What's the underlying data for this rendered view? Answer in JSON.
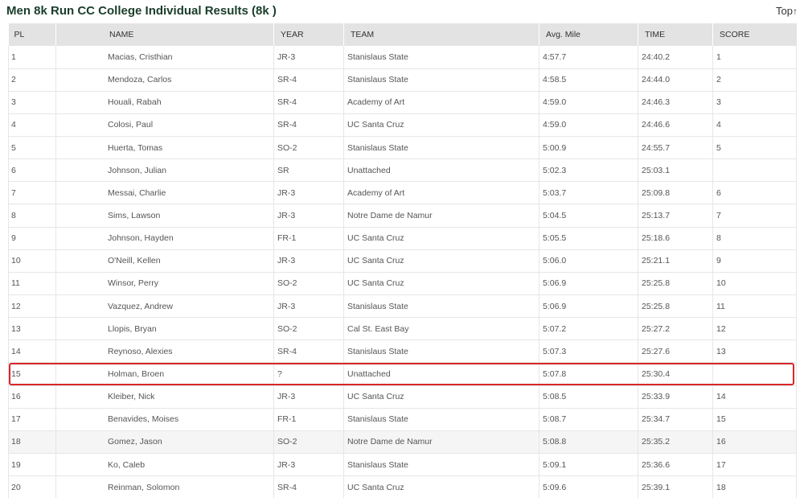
{
  "page": {
    "title": "Men 8k Run CC College Individual Results (8k )",
    "top_link": "Top",
    "top_arrow": "↑"
  },
  "table": {
    "columns": [
      "PL",
      "NAME",
      "YEAR",
      "TEAM",
      "Avg. Mile",
      "TIME",
      "SCORE"
    ],
    "rows": [
      [
        "1",
        "Macias, Cristhian",
        "JR-3",
        "Stanislaus State",
        "4:57.7",
        "24:40.2",
        "1"
      ],
      [
        "2",
        "Mendoza, Carlos",
        "SR-4",
        "Stanislaus State",
        "4:58.5",
        "24:44.0",
        "2"
      ],
      [
        "3",
        "Houali, Rabah",
        "SR-4",
        "Academy of Art",
        "4:59.0",
        "24:46.3",
        "3"
      ],
      [
        "4",
        "Colosi, Paul",
        "SR-4",
        "UC Santa Cruz",
        "4:59.0",
        "24:46.6",
        "4"
      ],
      [
        "5",
        "Huerta, Tomas",
        "SO-2",
        "Stanislaus State",
        "5:00.9",
        "24:55.7",
        "5"
      ],
      [
        "6",
        "Johnson, Julian",
        "SR",
        "Unattached",
        "5:02.3",
        "25:03.1",
        ""
      ],
      [
        "7",
        "Messai, Charlie",
        "JR-3",
        "Academy of Art",
        "5:03.7",
        "25:09.8",
        "6"
      ],
      [
        "8",
        "Sims, Lawson",
        "JR-3",
        "Notre Dame de Namur",
        "5:04.5",
        "25:13.7",
        "7"
      ],
      [
        "9",
        "Johnson, Hayden",
        "FR-1",
        "UC Santa Cruz",
        "5:05.5",
        "25:18.6",
        "8"
      ],
      [
        "10",
        "O'Neill, Kellen",
        "JR-3",
        "UC Santa Cruz",
        "5:06.0",
        "25:21.1",
        "9"
      ],
      [
        "11",
        "Winsor, Perry",
        "SO-2",
        "UC Santa Cruz",
        "5:06.9",
        "25:25.8",
        "10"
      ],
      [
        "12",
        "Vazquez, Andrew",
        "JR-3",
        "Stanislaus State",
        "5:06.9",
        "25:25.8",
        "11"
      ],
      [
        "13",
        "Llopis, Bryan",
        "SO-2",
        "Cal St. East Bay",
        "5:07.2",
        "25:27.2",
        "12"
      ],
      [
        "14",
        "Reynoso, Alexies",
        "SR-4",
        "Stanislaus State",
        "5:07.3",
        "25:27.6",
        "13"
      ],
      [
        "15",
        "Holman, Broen",
        "?",
        "Unattached",
        "5:07.8",
        "25:30.4",
        ""
      ],
      [
        "16",
        "Kleiber, Nick",
        "JR-3",
        "UC Santa Cruz",
        "5:08.5",
        "25:33.9",
        "14"
      ],
      [
        "17",
        "Benavides, Moises",
        "FR-1",
        "Stanislaus State",
        "5:08.7",
        "25:34.7",
        "15"
      ],
      [
        "18",
        "Gomez, Jason",
        "SO-2",
        "Notre Dame de Namur",
        "5:08.8",
        "25:35.2",
        "16"
      ],
      [
        "19",
        "Ko, Caleb",
        "JR-3",
        "Stanislaus State",
        "5:09.1",
        "25:36.6",
        "17"
      ],
      [
        "20",
        "Reinman, Solomon",
        "SR-4",
        "UC Santa Cruz",
        "5:09.6",
        "25:39.1",
        "18"
      ]
    ],
    "highlighted_row": 14,
    "shaded_row": 17
  },
  "colors": {
    "title": "#1a3d2a",
    "header_bg": "#e3e3e3",
    "highlight_border": "#d8262b",
    "alt_row_bg": "#f5f5f5"
  }
}
